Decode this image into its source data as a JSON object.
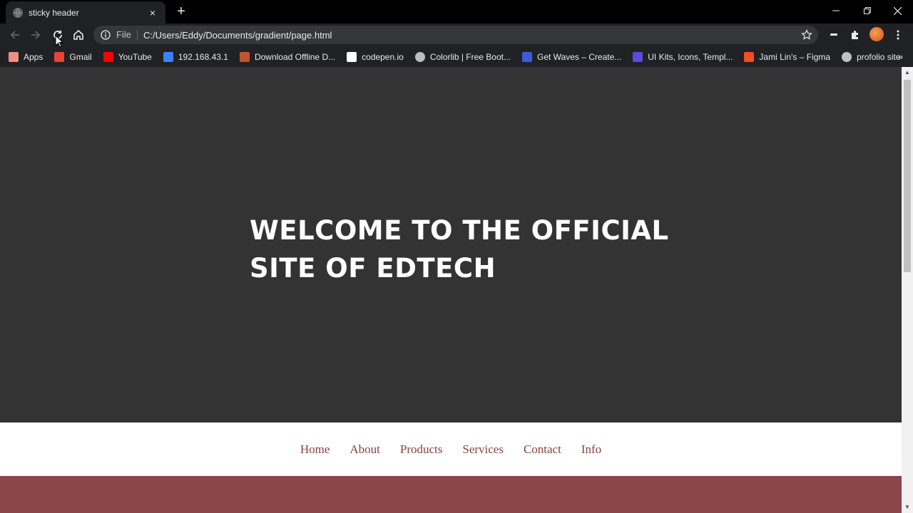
{
  "browser": {
    "tab": {
      "title": "sticky header",
      "close": "×"
    },
    "new_tab": "+",
    "window_controls": {
      "minimize": "—",
      "restore": "❐",
      "close": "✕"
    },
    "omnibox": {
      "scheme": "File",
      "url": "C:/Users/Eddy/Documents/gradient/page.html"
    },
    "bookmarks": [
      {
        "label": "Apps",
        "icon": "apps-grid-icon",
        "color": "#f28b82"
      },
      {
        "label": "Gmail",
        "icon": "gmail-icon",
        "color": "#ea4335"
      },
      {
        "label": "YouTube",
        "icon": "youtube-icon",
        "color": "#ff0000"
      },
      {
        "label": "192.168.43.1",
        "icon": "router-icon",
        "color": "#3b82f6"
      },
      {
        "label": "Download Offline D...",
        "icon": "book-icon",
        "color": "#c0552e"
      },
      {
        "label": "codepen.io",
        "icon": "codepen-icon",
        "color": "#ffffff"
      },
      {
        "label": "Colorlib | Free Boot...",
        "icon": "wordpress-icon",
        "color": "#bdbdbd"
      },
      {
        "label": "Get Waves – Create...",
        "icon": "waves-icon",
        "color": "#3b5bdb"
      },
      {
        "label": "UI Kits, Icons, Templ...",
        "icon": "uplabs-icon",
        "color": "#5b4bd6"
      },
      {
        "label": "Jami Lin's – Figma",
        "icon": "figma-icon",
        "color": "#f24e1e"
      },
      {
        "label": "profolio site",
        "icon": "globe-icon",
        "color": "#bdc1c6"
      }
    ],
    "bookmarks_more": "»"
  },
  "page": {
    "hero": {
      "line1": "WELCOME TO THE OFFICIAL",
      "line2": "SITE OF EDTECH"
    },
    "nav": [
      "Home",
      "About",
      "Products",
      "Services",
      "Contact",
      "Info"
    ]
  },
  "colors": {
    "hero_bg": "#333333",
    "nav_bg": "#ffffff",
    "nav_text": "#8b3e3e",
    "section_bg": "#8b464b"
  }
}
